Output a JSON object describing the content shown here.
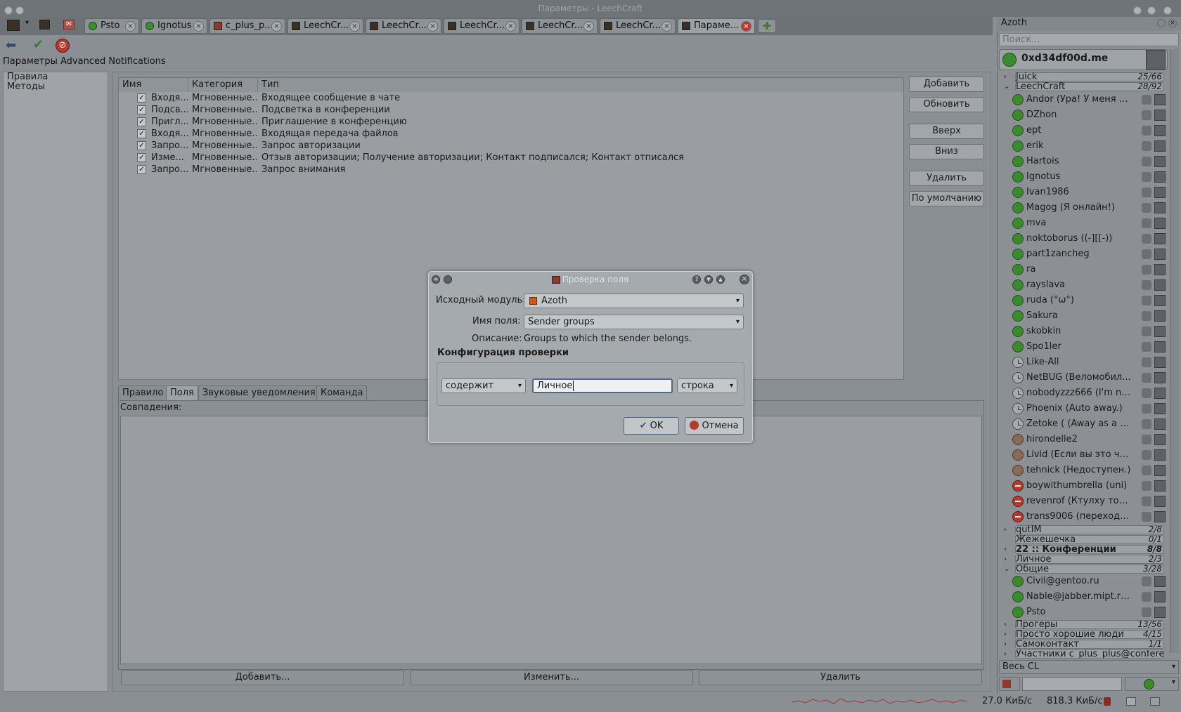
{
  "window": {
    "title": "Параметры - LeechCraft"
  },
  "tabs": [
    {
      "label": "Psto"
    },
    {
      "label": "Ignotus"
    },
    {
      "label": "c_plus_p..."
    },
    {
      "label": "LeechCr..."
    },
    {
      "label": "LeechCr..."
    },
    {
      "label": "LeechCr..."
    },
    {
      "label": "LeechCr..."
    },
    {
      "label": "LeechCr..."
    },
    {
      "label": "Параме..."
    }
  ],
  "breadcrumb": "Параметры Advanced Notifications",
  "leftlist": {
    "items": [
      "Правила",
      "Методы"
    ]
  },
  "table": {
    "headers": [
      "Имя",
      "Категория",
      "Тип"
    ],
    "rows": [
      {
        "name": "Входя...",
        "category": "Мгновенные...",
        "type": "Входящее сообщение в чате"
      },
      {
        "name": "Подсв...",
        "category": "Мгновенные...",
        "type": "Подсветка в конференции"
      },
      {
        "name": "Пригл...",
        "category": "Мгновенные...",
        "type": "Приглашение в конференцию"
      },
      {
        "name": "Входя...",
        "category": "Мгновенные...",
        "type": "Входящая передача файлов"
      },
      {
        "name": "Запро...",
        "category": "Мгновенные...",
        "type": "Запрос авторизации"
      },
      {
        "name": "Изме...",
        "category": "Мгновенные...",
        "type": "Отзыв авторизации; Получение авторизации; Контакт подписался; Контакт отписался"
      },
      {
        "name": "Запро...",
        "category": "Мгновенные...",
        "type": "Запрос внимания"
      }
    ],
    "check_mark": "✓"
  },
  "side_buttons": {
    "add": "Добавить",
    "update": "Обновить",
    "up": "Вверх",
    "down": "Вниз",
    "delete": "Удалить",
    "default": "По умолчанию"
  },
  "config_tabs": [
    "Правило",
    "Поля",
    "Звуковые уведомления",
    "Команда"
  ],
  "matches_label": "Совпадения:",
  "bottom_buttons": {
    "add": "Добавить...",
    "edit": "Изменить...",
    "delete": "Удалить"
  },
  "status": {
    "down": "27.0 КиБ/с",
    "up": "818.3 КиБ/с"
  },
  "dialog": {
    "title": "Проверка поля",
    "source_label": "Исходный модуль:",
    "source_value": "Azoth",
    "field_label": "Имя поля:",
    "field_value": "Sender groups",
    "desc_label": "Описание:",
    "desc_value": "Groups to which the sender belongs.",
    "group_title": "Конфигурация проверки",
    "op_value": "содержит",
    "input_value": "Личное",
    "type_value": "строка",
    "ok": "OK",
    "cancel": "Отмена"
  },
  "roster": {
    "title": "Azoth",
    "search_placeholder": "Поиск...",
    "self_account": "0xd34df00d.me",
    "groups_top": [
      {
        "name": "Juick",
        "count": "25/66"
      },
      {
        "name": "LeechCraft",
        "count": "28/92"
      }
    ],
    "contacts_lc": [
      {
        "name": "Andor (Ура! У меня н...",
        "status": "online"
      },
      {
        "name": "DZhon",
        "status": "online"
      },
      {
        "name": "ept",
        "status": "online"
      },
      {
        "name": "erik",
        "status": "online"
      },
      {
        "name": "Hartois",
        "status": "online"
      },
      {
        "name": "Ignotus",
        "status": "online"
      },
      {
        "name": "Ivan1986",
        "status": "online"
      },
      {
        "name": "Magog (Я онлайн!)",
        "status": "online"
      },
      {
        "name": "mva",
        "status": "online"
      },
      {
        "name": "noktoborus ((-][[-))",
        "status": "online"
      },
      {
        "name": "part1zancheg",
        "status": "online"
      },
      {
        "name": "ra",
        "status": "online"
      },
      {
        "name": "rayslava",
        "status": "online"
      },
      {
        "name": "ruda (°ω°)",
        "status": "online"
      },
      {
        "name": "Sakura",
        "status": "online"
      },
      {
        "name": "skobkin",
        "status": "online"
      },
      {
        "name": "Spo1ler",
        "status": "online"
      },
      {
        "name": "Like-All",
        "status": "away"
      },
      {
        "name": "NetBUG (Веломобил...",
        "status": "away"
      },
      {
        "name": "nobodyzzz666 (I'm not ...",
        "status": "away"
      },
      {
        "name": "Phoenix (Auto away.)",
        "status": "away"
      },
      {
        "name": "Zetoke ( (Away as a res...",
        "status": "away"
      },
      {
        "name": "hirondelle2",
        "status": "xa"
      },
      {
        "name": "Livid (Если вы это чита...",
        "status": "xa"
      },
      {
        "name": "tehnick (Недоступен.)",
        "status": "xa"
      },
      {
        "name": "boywithumbrella (uni)",
        "status": "dnd"
      },
      {
        "name": "revenrof (Ктулху тоже ...",
        "status": "dnd"
      },
      {
        "name": "trans9006 (переходим ...",
        "status": "dnd"
      }
    ],
    "groups_mid": [
      {
        "name": "qutIM",
        "count": "2/8"
      },
      {
        "name": "Жежешечка",
        "count": "0/1"
      },
      {
        "name": "22 :: Конференции",
        "count": "8/8"
      },
      {
        "name": "Личное",
        "count": "2/3"
      },
      {
        "name": "Общие",
        "count": "3/28"
      }
    ],
    "contacts_common": [
      {
        "name": "Civil@gentoo.ru",
        "status": "online"
      },
      {
        "name": "Nable@jabber.mipt.ru (Y...",
        "status": "online"
      },
      {
        "name": "Psto",
        "status": "online"
      }
    ],
    "groups_bottom": [
      {
        "name": "Прогеры",
        "count": "13/56"
      },
      {
        "name": "Просто хорошие люди",
        "count": "4/15"
      },
      {
        "name": "Самоконтакт",
        "count": "1/1"
      },
      {
        "name": "Участники c_plus_plus@confere...",
        "count": ""
      }
    ],
    "filter_value": "Весь CL"
  }
}
